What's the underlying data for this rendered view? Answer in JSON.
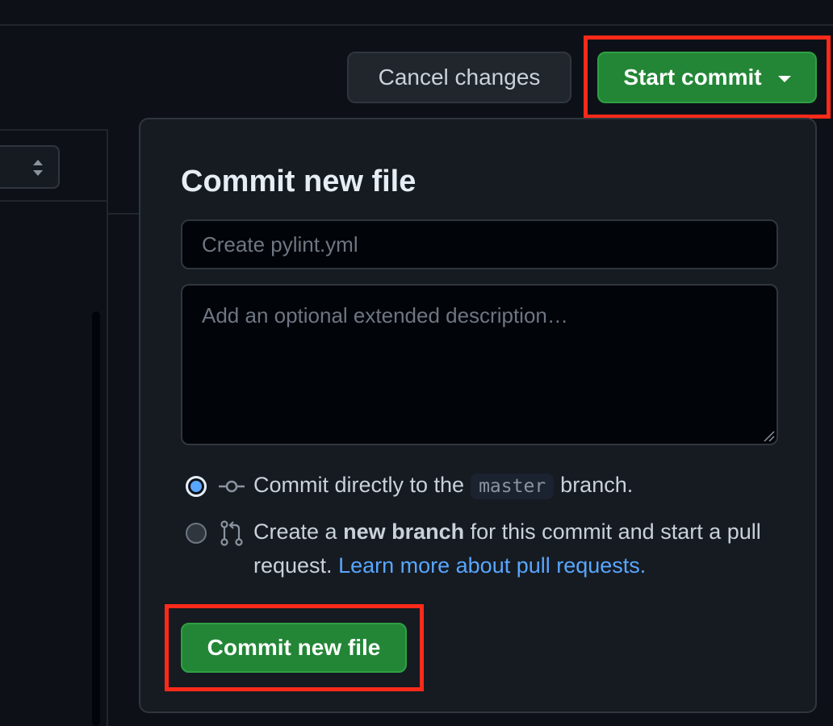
{
  "toolbar": {
    "cancel_label": "Cancel changes",
    "start_commit_label": "Start commit"
  },
  "panel": {
    "title": "Commit new file",
    "summary_placeholder": "Create pylint.yml",
    "description_placeholder": "Add an optional extended description…",
    "option_direct": {
      "prefix": "Commit directly to the",
      "branch": "master",
      "suffix": "branch.",
      "checked": true
    },
    "option_new_branch": {
      "prefix": "Create a",
      "bold": "new branch",
      "middle": "for this commit and start a pull request.",
      "link": "Learn more about pull requests.",
      "checked": false
    },
    "commit_button_label": "Commit new file"
  },
  "icons": [
    "updown-arrows-icon",
    "caret-down-icon",
    "git-commit-icon",
    "git-pull-request-icon",
    "resize-grip-icon"
  ],
  "colors": {
    "background": "#0d1117",
    "panel": "#161b22",
    "primary_green": "#238636",
    "link_blue": "#58a6ff",
    "highlight_red": "#ff2a1a"
  }
}
